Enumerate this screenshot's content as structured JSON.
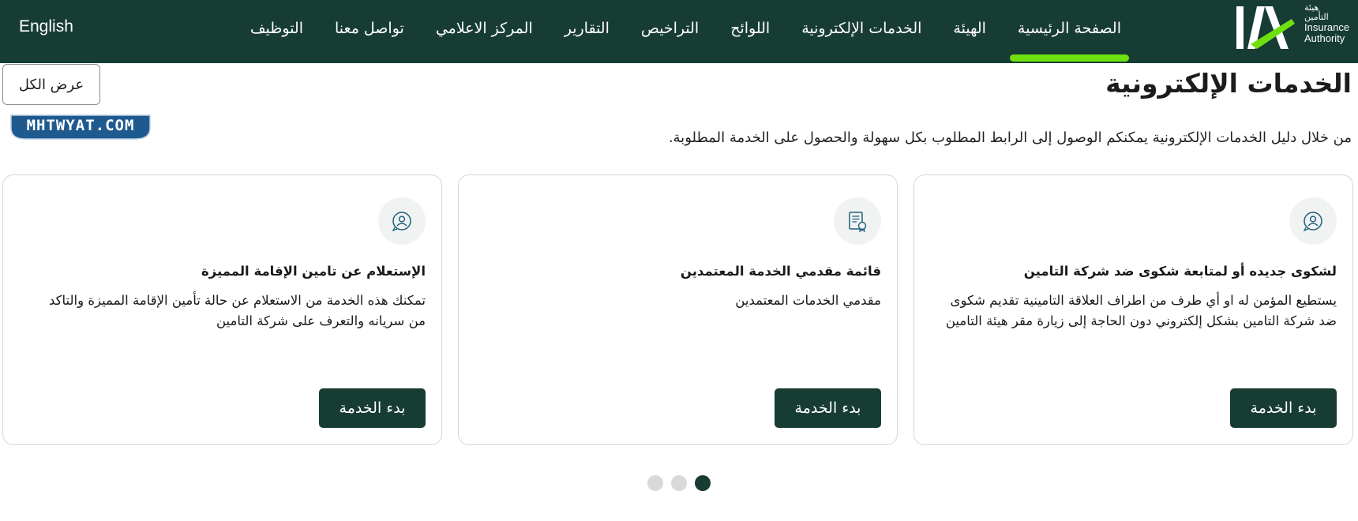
{
  "header": {
    "language_link": "English",
    "nav_items": [
      {
        "label": "الصفحة الرئيسية",
        "active": true
      },
      {
        "label": "الهيئة",
        "active": false
      },
      {
        "label": "الخدمات الإلكترونية",
        "active": false
      },
      {
        "label": "اللوائح",
        "active": false
      },
      {
        "label": "التراخيص",
        "active": false
      },
      {
        "label": "التقارير",
        "active": false
      },
      {
        "label": "المركز الاعلامي",
        "active": false
      },
      {
        "label": "تواصل معنا",
        "active": false
      },
      {
        "label": "التوظيف",
        "active": false
      }
    ],
    "logo": {
      "mark": "IA",
      "arabic_line1": "هيئة",
      "arabic_line2": "التأمين",
      "english_line1": "Insurance",
      "english_line2": "Authority"
    }
  },
  "section": {
    "title": "الخدمات الإلكترونية",
    "subtitle": "من خلال دليل الخدمات الإلكترونية يمكنكم الوصول إلى الرابط المطلوب بكل سهولة والحصول على الخدمة المطلوبة.",
    "view_all": "عرض الكل"
  },
  "watermark": "MHTWYAT.COM",
  "cards": [
    {
      "icon": "person-chat-icon",
      "title": "لشكوى جديده أو لمتابعة شكوى ضد شركة التامين",
      "description": "يستطيع المؤمن له او أي طرف من اطراف العلاقة التامينية تقديم شكوى ضد شركة التامين بشكل إلكتروني دون الحاجة إلى زيارة مقر هيئة التامين",
      "button": "بدء الخدمة"
    },
    {
      "icon": "document-certificate-icon",
      "title": "قائمة مقدمي الخدمة المعتمدين",
      "description": "مقدمي الخدمات المعتمدين",
      "button": "بدء الخدمة"
    },
    {
      "icon": "person-chat-icon",
      "title": "الإستعلام عن تامين الإقامة المميزة",
      "description": "تمكنك هذه الخدمة من الاستعلام عن حالة تأمين الإقامة المميزة والتاكد من سريانه والتعرف على شركة التامين",
      "button": "بدء الخدمة"
    }
  ],
  "pagination": {
    "active_page": 1,
    "page_count": 3
  },
  "colors": {
    "header_bg": "#173c34",
    "accent_green": "#6ee00f",
    "button_bg": "#173c34",
    "watermark_bg": "#1f5a8f"
  }
}
